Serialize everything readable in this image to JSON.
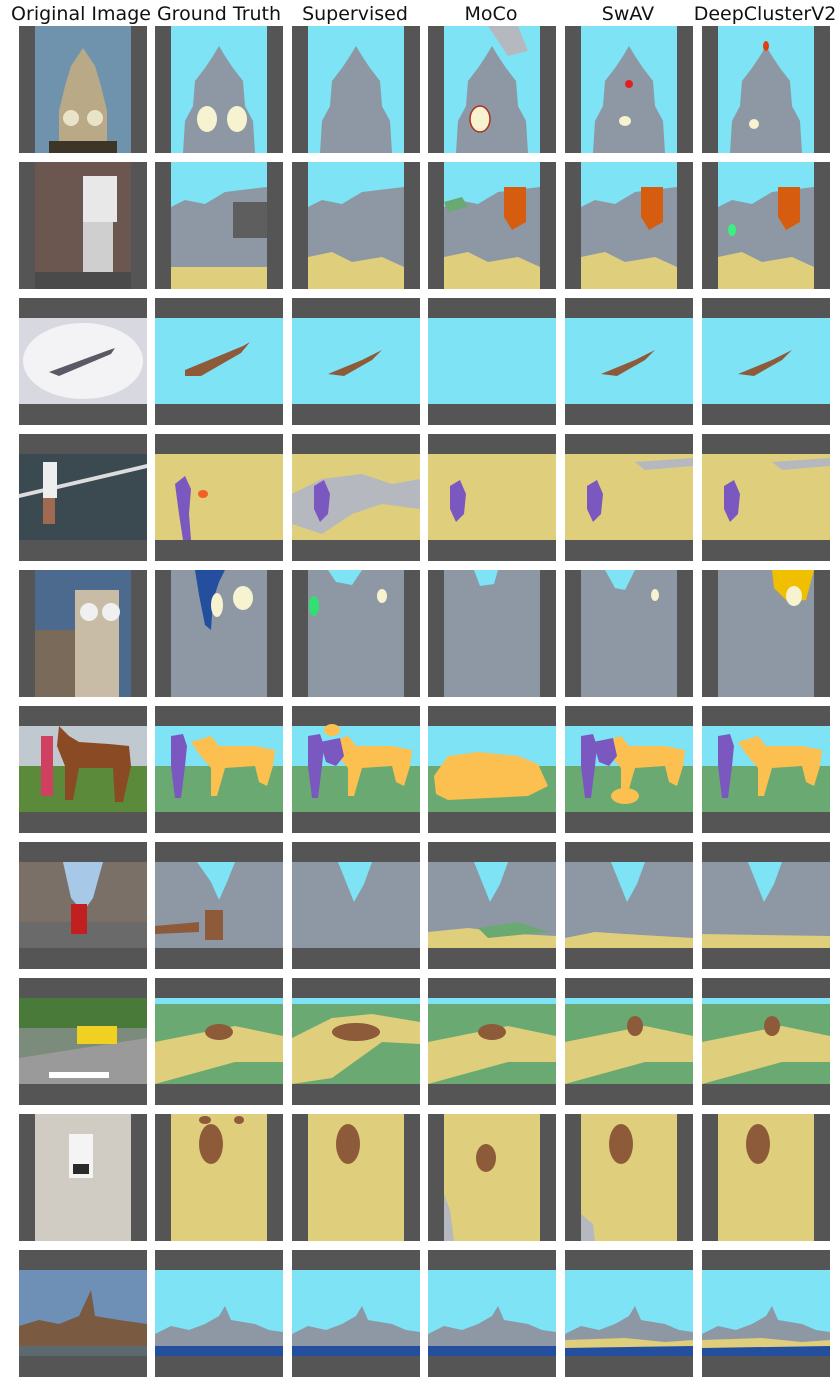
{
  "columns": [
    "Original Image",
    "Ground Truth",
    "Supervised",
    "MoCo",
    "SwAV",
    "DeepClusterV2"
  ],
  "colors": {
    "background_gray": "#555555",
    "sky": "#7de3f5",
    "building": "#8d98a4",
    "road": "#dfce7c",
    "grass": "#6aaa72",
    "person": "#7b58c0",
    "animal": "#fbc04f",
    "vehicle": "#8e5b3a",
    "clock": "#f7f2cf",
    "sign": "#d65d10",
    "water": "#244f9e",
    "light_gray": "#b5b8bf"
  },
  "rows": [
    {
      "name": "clock-tower",
      "kind": "tower"
    },
    {
      "name": "park-here-sign",
      "kind": "street-sign"
    },
    {
      "name": "airplane",
      "kind": "plane"
    },
    {
      "name": "tennis-player",
      "kind": "tennis"
    },
    {
      "name": "clock-building",
      "kind": "clocktower2"
    },
    {
      "name": "woman-horse",
      "kind": "horse"
    },
    {
      "name": "city-street-bus",
      "kind": "street"
    },
    {
      "name": "yellow-bus-road",
      "kind": "bus"
    },
    {
      "name": "bus-on-road",
      "kind": "bus2"
    },
    {
      "name": "parliament-river",
      "kind": "river"
    }
  ]
}
